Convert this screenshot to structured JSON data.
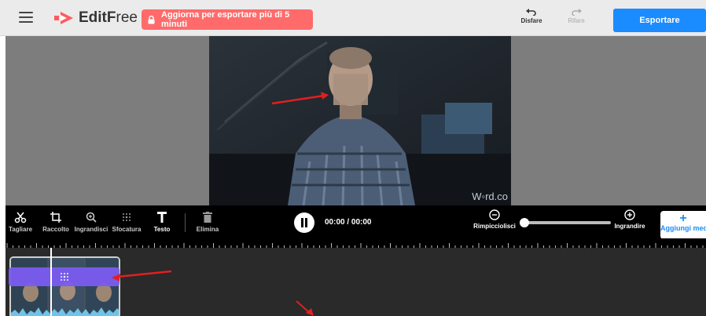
{
  "header": {
    "menu_icon": "hamburger-menu-icon",
    "logo_bold": "EditF",
    "logo_rest": "ree",
    "upgrade_label": "Aggiorna per esportare più di 5 minuti",
    "undo_label": "Disfare",
    "redo_label": "Rifare",
    "export_label": "Esportare"
  },
  "preview": {
    "watermark": "W◦rd.co"
  },
  "toolbar": {
    "tools": [
      {
        "label": "Tagliare",
        "icon": "scissors-icon"
      },
      {
        "label": "Raccolto",
        "icon": "crop-icon"
      },
      {
        "label": "Ingrandisci",
        "icon": "zoom-in-icon"
      },
      {
        "label": "Sfocatura",
        "icon": "blur-icon"
      },
      {
        "label": "Testo",
        "icon": "text-icon"
      },
      {
        "label": "Elimina",
        "icon": "trash-icon"
      }
    ],
    "time": "00:00 / 00:00",
    "zoom_out_label": "Rimpicciolisci",
    "zoom_in_label": "Ingrandire",
    "add_media_label": "Aggiungi media",
    "zoom_level": 0
  },
  "colors": {
    "accent": "#1a8cff",
    "upgrade": "#ff6b6b",
    "blur_bar": "#7b5cf0",
    "annotation_arrow": "#e02020"
  }
}
